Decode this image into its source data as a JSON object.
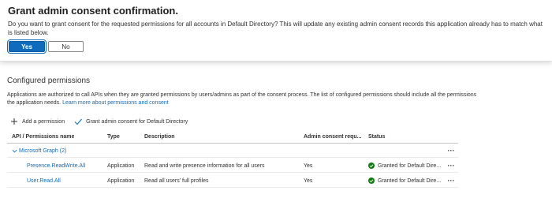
{
  "dialog": {
    "title": "Grant admin consent confirmation.",
    "message": "Do you want to grant consent for the requested permissions for all accounts in Default Directory? This will update any existing admin consent records this application already has to match what is listed below.",
    "yes_label": "Yes",
    "no_label": "No"
  },
  "section": {
    "title": "Configured permissions",
    "description": "Applications are authorized to call APIs when they are granted permissions by users/admins as part of the consent process. The list of configured permissions should include all the permissions the application needs.",
    "learn_more": "Learn more about permissions and consent"
  },
  "toolbar": {
    "add_permission": "Add a permission",
    "grant_consent": "Grant admin consent for Default Directory"
  },
  "table": {
    "headers": {
      "api": "API / Permissions name",
      "type": "Type",
      "description": "Description",
      "admin_consent": "Admin consent requ...",
      "status": "Status"
    },
    "group": {
      "label": "Microsoft Graph (2)",
      "more": "···"
    },
    "rows": [
      {
        "name": "Presence.ReadWrite.All",
        "type": "Application",
        "description": "Read and write presence information for all users",
        "admin_consent": "Yes",
        "status": "Granted for Default Dire...",
        "more": "···"
      },
      {
        "name": "User.Read.All",
        "type": "Application",
        "description": "Read all users' full profiles",
        "admin_consent": "Yes",
        "status": "Granted for Default Dire...",
        "more": "···"
      }
    ]
  },
  "colors": {
    "accent": "#0f6cbd",
    "success": "#107c10",
    "text": "#323130"
  },
  "icons": {
    "add": "plus-icon",
    "grant": "checkmark-icon",
    "expand": "chevron-down-icon",
    "status": "success-check-icon"
  }
}
